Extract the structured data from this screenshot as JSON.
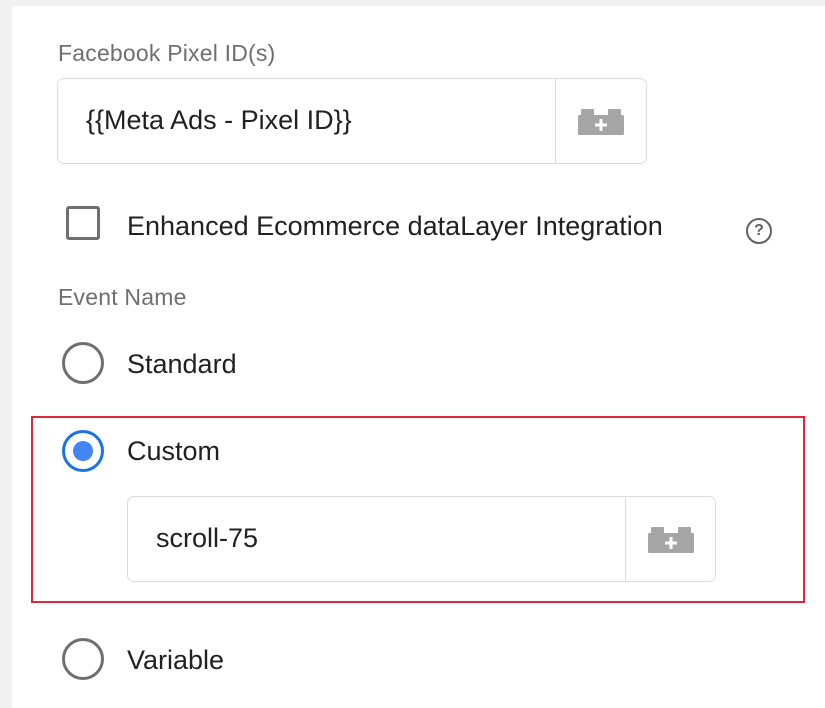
{
  "pixel_field": {
    "label": "Facebook Pixel ID(s)",
    "value": "{{Meta Ads - Pixel ID}}"
  },
  "enhanced_ecommerce": {
    "label": "Enhanced Ecommerce dataLayer Integration",
    "checked": false,
    "help_icon": "?"
  },
  "event_name": {
    "label": "Event Name",
    "options": [
      {
        "label": "Standard",
        "selected": false
      },
      {
        "label": "Custom",
        "selected": true
      },
      {
        "label": "Variable",
        "selected": false
      }
    ],
    "custom_value": "scroll-75"
  },
  "colors": {
    "accent": "#1a73e8",
    "highlight": "#e0263b",
    "icon": "#a5a5a5"
  },
  "icons": {
    "variable_picker": "variable-brick-plus-icon",
    "help": "help-circle-icon"
  }
}
